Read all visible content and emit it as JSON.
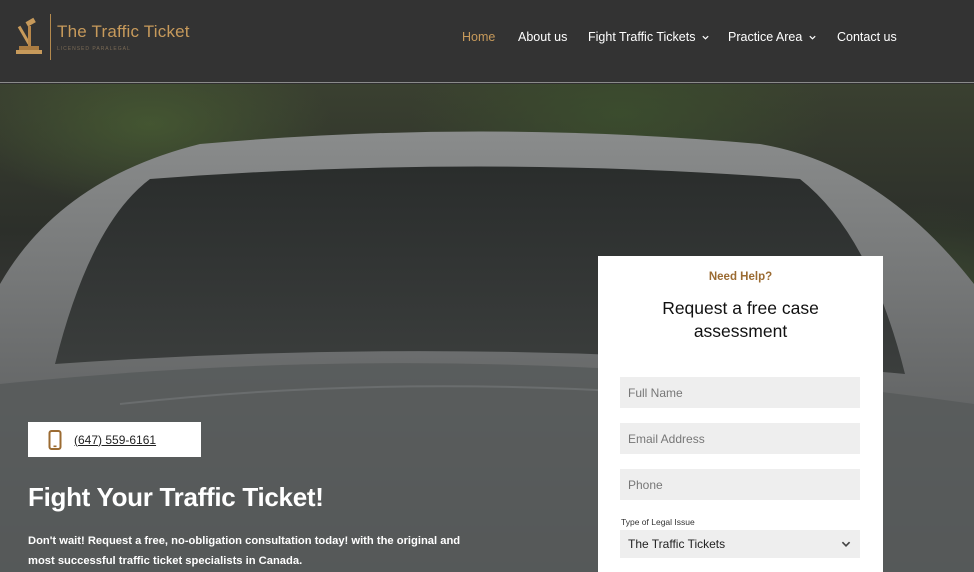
{
  "header": {
    "logo_title": "The Traffic Ticket",
    "logo_subtitle": "LICENSED PARALEGAL",
    "nav": [
      {
        "label": "Home",
        "active": true,
        "has_dropdown": false
      },
      {
        "label": "About us",
        "active": false,
        "has_dropdown": false
      },
      {
        "label": "Fight Traffic Tickets",
        "active": false,
        "has_dropdown": true
      },
      {
        "label": "Practice Area",
        "active": false,
        "has_dropdown": true
      },
      {
        "label": "Contact us",
        "active": false,
        "has_dropdown": false
      }
    ]
  },
  "hero": {
    "phone": "(647) 559-6161",
    "title": "Fight Your Traffic Ticket!",
    "text": "Don't wait! Request a free, no-obligation consultation today! with the original and most successful traffic ticket specialists in Canada."
  },
  "form": {
    "eyebrow": "Need Help?",
    "title": "Request a free case assessment",
    "full_name_placeholder": "Full Name",
    "email_placeholder": "Email Address",
    "phone_placeholder": "Phone",
    "legal_issue_label": "Type of Legal Issue",
    "legal_issue_value": "The Traffic Tickets"
  },
  "colors": {
    "accent": "#c79a5b",
    "header_bg": "#333333",
    "eyebrow": "#9b6b32"
  },
  "icons": [
    "gavel-logo-icon",
    "chevron-down-icon",
    "mobile-phone-icon"
  ]
}
